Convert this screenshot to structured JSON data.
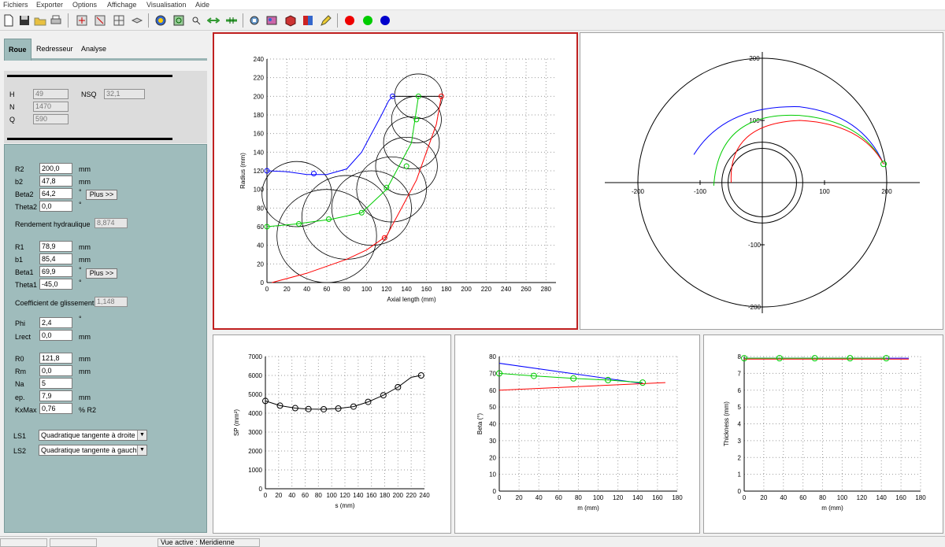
{
  "menu": [
    "Fichiers",
    "Exporter",
    "Options",
    "Affichage",
    "Visualisation",
    "Aide"
  ],
  "tabs": [
    "Roue",
    "Redresseur",
    "Analyse"
  ],
  "info": {
    "H_label": "H",
    "H": "49",
    "NSQ_label": "NSQ",
    "NSQ": "32,1",
    "N_label": "N",
    "N": "1470",
    "Q_label": "Q",
    "Q": "590"
  },
  "params": {
    "R2_label": "R2",
    "R2": "200,0",
    "R2_unit": "mm",
    "b2_label": "b2",
    "b2": "47,8",
    "b2_unit": "mm",
    "Beta2_label": "Beta2",
    "Beta2": "64,2",
    "Beta2_unit": "°",
    "Theta2_label": "Theta2",
    "Theta2": "0,0",
    "Theta2_unit": "°",
    "plus_label": "Plus >>",
    "rend_label": "Rendement hydraulique",
    "rend": "8,874",
    "R1_label": "R1",
    "R1": "78,9",
    "R1_unit": "mm",
    "b1_label": "b1",
    "b1": "85,4",
    "b1_unit": "mm",
    "Beta1_label": "Beta1",
    "Beta1": "69,9",
    "Beta1_unit": "°",
    "Theta1_label": "Theta1",
    "Theta1": "-45,0",
    "Theta1_unit": "°",
    "coef_label": "Coefficient de glissement",
    "coef": "1,148",
    "Phi_label": "Phi",
    "Phi": "2,4",
    "Phi_unit": "°",
    "Lrect_label": "Lrect",
    "Lrect": "0,0",
    "Lrect_unit": "mm",
    "R0_label": "R0",
    "R0": "121,8",
    "R0_unit": "mm",
    "Rm_label": "Rm",
    "Rm": "0,0",
    "Rm_unit": "mm",
    "Na_label": "Na",
    "Na": "5",
    "ep_label": "ep.",
    "ep": "7,9",
    "ep_unit": "mm",
    "KxMax_label": "KxMax",
    "KxMax": "0,76",
    "KxMax_unit": "% R2",
    "LS1_label": "LS1",
    "LS1": "Quadratique tangente à droite",
    "LS2_label": "LS2",
    "LS2": "Quadratique tangente à gauche"
  },
  "status": {
    "active_view": "Vue active : Meridienne"
  },
  "colors": {
    "blue": "#0000ff",
    "green": "#00cc00",
    "red": "#ff0000",
    "panel_teal": "#9fbcbc"
  },
  "toolbar_icons": [
    "new-icon",
    "save-icon",
    "open-icon",
    "print-icon",
    "tool-1-icon",
    "tool-2-icon",
    "grid-icon",
    "layers-icon",
    "globe-icon",
    "refresh-icon",
    "zoom-icon",
    "arrows-icon",
    "arrows-2-icon",
    "tool-3-icon",
    "tool-4-icon",
    "cube-icon",
    "book-icon",
    "pencil-icon",
    "red-dot-icon",
    "green-dot-icon",
    "blue-dot-icon"
  ],
  "chart_data": [
    {
      "type": "line",
      "name": "meridional",
      "xlabel": "Axial length (mm)",
      "ylabel": "Radius (mm)",
      "xlim": [
        0,
        290
      ],
      "ylim": [
        0,
        240
      ],
      "xticks": [
        0,
        20,
        40,
        60,
        80,
        100,
        120,
        140,
        160,
        180,
        200,
        220,
        240,
        260,
        280
      ],
      "yticks": [
        0,
        20,
        40,
        60,
        80,
        100,
        120,
        140,
        160,
        180,
        200,
        220,
        240
      ],
      "series": [
        {
          "color": "blue",
          "x": [
            0,
            20,
            40,
            60,
            80,
            95,
            105,
            115,
            122,
            126
          ],
          "y": [
            120,
            119,
            116,
            116,
            122,
            140,
            160,
            180,
            195,
            200
          ]
        },
        {
          "color": "green",
          "x": [
            0,
            30,
            65,
            95,
            120,
            145,
            152
          ],
          "y": [
            60,
            63,
            68,
            75,
            100,
            150,
            200
          ]
        },
        {
          "color": "red",
          "x": [
            5,
            40,
            80,
            100,
            120,
            150,
            170,
            175
          ],
          "y": [
            0,
            10,
            25,
            35,
            50,
            110,
            170,
            200
          ]
        },
        {
          "color": "black",
          "x": [
            126,
            175
          ],
          "y": [
            200,
            200
          ]
        }
      ],
      "circles": [
        [
          152,
          200,
          24
        ],
        [
          150,
          175,
          25
        ],
        [
          145,
          150,
          28
        ],
        [
          140,
          125,
          31
        ],
        [
          125,
          100,
          35
        ],
        [
          105,
          80,
          40
        ],
        [
          80,
          70,
          45
        ],
        [
          60,
          50,
          50
        ],
        [
          30,
          95,
          35
        ]
      ]
    },
    {
      "type": "line",
      "name": "polar",
      "xlim": [
        -200,
        200
      ],
      "ylim": [
        -200,
        200
      ],
      "xticks": [
        -200,
        -100,
        100,
        200
      ],
      "yticks": [
        200,
        100,
        -100,
        -200
      ],
      "circles_r": [
        200,
        65,
        55
      ]
    },
    {
      "type": "line",
      "name": "SP",
      "xlabel": "s (mm)",
      "ylabel": "SP (mm²)",
      "xlim": [
        0,
        240
      ],
      "ylim": [
        0,
        7000
      ],
      "xticks": [
        0,
        20,
        40,
        60,
        80,
        100,
        120,
        140,
        160,
        180,
        200,
        220,
        240
      ],
      "yticks": [
        0,
        1000,
        2000,
        3000,
        4000,
        5000,
        6000,
        7000
      ],
      "series": [
        {
          "color": "black",
          "x": [
            0,
            22,
            45,
            65,
            88,
            110,
            133,
            155,
            178,
            200,
            220,
            235
          ],
          "y": [
            4650,
            4400,
            4270,
            4220,
            4210,
            4250,
            4350,
            4600,
            4950,
            5380,
            5900,
            6000
          ]
        }
      ],
      "markers_x": [
        0,
        22,
        45,
        65,
        88,
        110,
        133,
        155,
        178,
        200,
        235
      ],
      "markers_y": [
        4650,
        4400,
        4270,
        4220,
        4210,
        4250,
        4350,
        4600,
        4950,
        5380,
        6000
      ]
    },
    {
      "type": "line",
      "name": "Beta",
      "xlabel": "m (mm)",
      "ylabel": "Beta (°)",
      "xlim": [
        0,
        180
      ],
      "ylim": [
        0,
        80
      ],
      "xticks": [
        0,
        20,
        40,
        60,
        80,
        100,
        120,
        140,
        160,
        180
      ],
      "yticks": [
        0,
        10,
        20,
        30,
        40,
        50,
        60,
        70,
        80
      ],
      "series": [
        {
          "color": "blue",
          "x": [
            0,
            145
          ],
          "y": [
            76,
            64
          ]
        },
        {
          "color": "green",
          "x": [
            0,
            35,
            75,
            110,
            145
          ],
          "y": [
            70,
            68.5,
            67,
            66,
            64.5
          ]
        },
        {
          "color": "red",
          "x": [
            0,
            168
          ],
          "y": [
            60,
            64.5
          ]
        }
      ]
    },
    {
      "type": "line",
      "name": "Thickness",
      "xlabel": "m (mm)",
      "ylabel": "Thickness (mm)",
      "xlim": [
        0,
        180
      ],
      "ylim": [
        0,
        8
      ],
      "xticks": [
        0,
        20,
        40,
        60,
        80,
        100,
        120,
        140,
        160,
        180
      ],
      "yticks": [
        0,
        1,
        2,
        3,
        4,
        5,
        6,
        7,
        8
      ],
      "series": [
        {
          "color": "blue",
          "x": [
            0,
            168
          ],
          "y": [
            7.9,
            7.9
          ]
        },
        {
          "color": "green",
          "x": [
            0,
            145
          ],
          "y": [
            7.9,
            7.9
          ]
        },
        {
          "color": "red",
          "x": [
            0,
            168
          ],
          "y": [
            7.85,
            7.85
          ]
        }
      ]
    }
  ]
}
